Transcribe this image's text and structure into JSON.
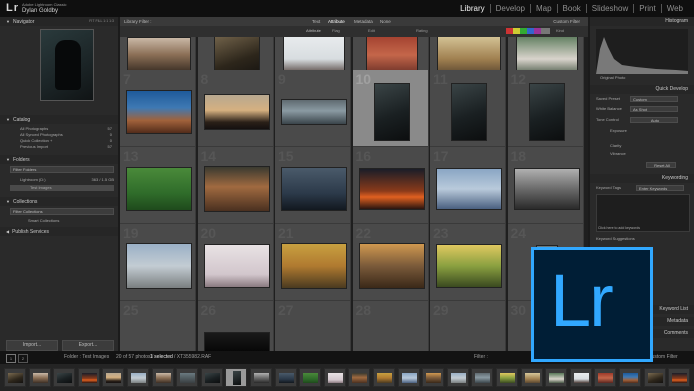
{
  "app": {
    "logo": "Lr",
    "title": "Adobe Lightroom Classic",
    "user": "Dylan Goldby"
  },
  "modules": [
    {
      "label": "Library",
      "active": true
    },
    {
      "label": "Develop",
      "active": false
    },
    {
      "label": "Map",
      "active": false
    },
    {
      "label": "Book",
      "active": false
    },
    {
      "label": "Slideshow",
      "active": false
    },
    {
      "label": "Print",
      "active": false
    },
    {
      "label": "Web",
      "active": false
    }
  ],
  "left": {
    "navigator": "Navigator",
    "nav_zoom": "FIT  FILL  1:1  1:3",
    "catalog": "Catalog",
    "catalog_items": [
      {
        "label": "All Photographs",
        "count": "57"
      },
      {
        "label": "All Synced Photographs",
        "count": "0"
      },
      {
        "label": "Quick Collection +",
        "count": "0"
      },
      {
        "label": "Previous Import",
        "count": "57"
      }
    ],
    "folders": "Folders",
    "folder_filter": "Filter Folders",
    "volume": "Lightroom (D:)",
    "volume_size": "363 / 1.5 GB",
    "folder_item": "Test Images",
    "collections": "Collections",
    "collection_filter": "Filter Collections",
    "smart_collections": "Smart Collections",
    "publish": "Publish Services",
    "import_btn": "Import...",
    "export_btn": "Export..."
  },
  "library_filter": {
    "title": "Library Filter :",
    "tabs": [
      "Text",
      "Attribute",
      "Metadata",
      "None"
    ],
    "active_tab": "Attribute",
    "preset": "Custom Filter",
    "attribute_label": "Attribute",
    "flag_label": "Flag",
    "edit_label": "Edit",
    "rating_label": "Rating",
    "kind_label": "Kind"
  },
  "grid": {
    "cells": [
      {
        "num": "",
        "sel": false,
        "photo": "brown"
      },
      {
        "num": "",
        "sel": false,
        "photo": "dark"
      },
      {
        "num": "",
        "sel": false,
        "photo": "snow"
      },
      {
        "num": "",
        "sel": false,
        "photo": "red"
      },
      {
        "num": "",
        "sel": false,
        "photo": "warm"
      },
      {
        "num": "",
        "sel": false,
        "photo": "wedding"
      },
      {
        "num": "7",
        "sel": false,
        "photo": "ruin"
      },
      {
        "num": "8",
        "sel": false,
        "photo": "sunset"
      },
      {
        "num": "9",
        "sel": false,
        "photo": "sea"
      },
      {
        "num": "10",
        "sel": true,
        "photo": "portrait"
      },
      {
        "num": "11",
        "sel": false,
        "photo": "portrait"
      },
      {
        "num": "12",
        "sel": false,
        "photo": "portrait"
      },
      {
        "num": "13",
        "sel": false,
        "photo": "field"
      },
      {
        "num": "14",
        "sel": false,
        "photo": "man"
      },
      {
        "num": "15",
        "sel": false,
        "photo": "lake"
      },
      {
        "num": "16",
        "sel": false,
        "photo": "orange"
      },
      {
        "num": "17",
        "sel": false,
        "photo": "boat"
      },
      {
        "num": "18",
        "sel": false,
        "photo": "mono"
      },
      {
        "num": "19",
        "sel": false,
        "photo": "city"
      },
      {
        "num": "20",
        "sel": false,
        "photo": "pale"
      },
      {
        "num": "21",
        "sel": false,
        "photo": "autumn"
      },
      {
        "num": "22",
        "sel": false,
        "photo": "couple"
      },
      {
        "num": "23",
        "sel": false,
        "photo": "park"
      },
      {
        "num": "24",
        "sel": false,
        "photo": "misc"
      },
      {
        "num": "25",
        "sel": false,
        "photo": "none"
      },
      {
        "num": "26",
        "sel": false,
        "photo": "black"
      },
      {
        "num": "27",
        "sel": false,
        "photo": "none"
      },
      {
        "num": "28",
        "sel": false,
        "photo": "none"
      },
      {
        "num": "29",
        "sel": false,
        "photo": "none"
      },
      {
        "num": "30",
        "sel": false,
        "photo": "none"
      }
    ]
  },
  "right": {
    "histogram": "Histogram",
    "original_photo": "Original Photo",
    "quick_develop": "Quick Develop",
    "saved_preset": "Saved Preset",
    "saved_preset_val": "Custom",
    "white_balance": "White Balance",
    "white_balance_val": "As Shot",
    "tone_control": "Tone Control",
    "tone_auto": "Auto",
    "exposure": "Exposure",
    "clarity": "Clarity",
    "vibrance": "Vibrance",
    "reset_all": "Reset All",
    "keywording": "Keywording",
    "keyword_tags": "Keyword Tags",
    "keyword_tags_val": "Enter Keywords",
    "click_add": "Click here to add keywords",
    "keyword_suggestions": "Keyword Suggestions",
    "keyword_list": "Keyword List",
    "metadata": "Metadata",
    "comments": "Comments"
  },
  "bottom": {
    "page1": "1",
    "page2": "2",
    "path": "Folder : Test Images",
    "count": "20 of 57 photos /",
    "selected": "1 selected",
    "file": "/ XT355982.RAF",
    "filter_label": "Filter :",
    "filter_value": "Custom Filter"
  },
  "filmstrip": [
    "dark",
    "brown",
    "portrait",
    "orange",
    "sunset",
    "city",
    "brown",
    "misc",
    "portrait",
    "sel",
    "mono",
    "lake",
    "field",
    "pale",
    "man",
    "autumn",
    "boat",
    "couple",
    "city",
    "sea",
    "park",
    "warm",
    "wedding",
    "snow",
    "red",
    "ruin",
    "dark",
    "orange"
  ],
  "colors": {
    "accent": "#31a8ff",
    "badge_bg": "#001e36"
  }
}
